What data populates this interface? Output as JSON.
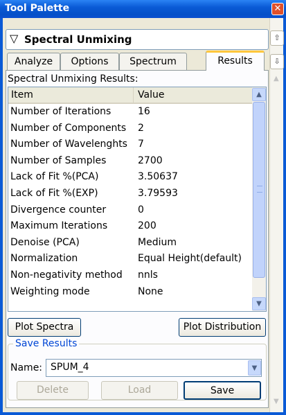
{
  "window": {
    "title": "Tool Palette",
    "close_glyph": "✕"
  },
  "header": {
    "label": "Spectral Unmixing",
    "collapse_glyph": "▽"
  },
  "tabs": [
    {
      "label": "Analyze"
    },
    {
      "label": "Options"
    },
    {
      "label": "Spectrum"
    },
    {
      "label": "Results",
      "active": true
    }
  ],
  "results": {
    "section_label": "Spectral Unmixing Results:",
    "columns": [
      "Item",
      "Value"
    ],
    "rows": [
      [
        "Number of Iterations",
        "16"
      ],
      [
        "Number of Components",
        "2"
      ],
      [
        "Number of Wavelenghts",
        "7"
      ],
      [
        "Number of Samples",
        "2700"
      ],
      [
        "Lack of Fit %(PCA)",
        "3.50637"
      ],
      [
        "Lack of Fit %(EXP)",
        "3.79593"
      ],
      [
        "Divergence counter",
        "0"
      ],
      [
        "Maximum Iterations",
        "200"
      ],
      [
        "Denoise (PCA)",
        "Medium"
      ],
      [
        "Normalization",
        "Equal Height(default)"
      ],
      [
        "Non-negativity method",
        "nnls"
      ],
      [
        "Weighting mode",
        "None"
      ]
    ]
  },
  "buttons": {
    "plot_spectra": "Plot Spectra",
    "plot_distribution": "Plot Distribution",
    "delete": "Delete",
    "load": "Load",
    "save": "Save"
  },
  "save_results": {
    "group_title": "Save Results",
    "name_label": "Name:",
    "name_value": "SPUM_4"
  },
  "icons": {
    "scroll_up": "▲",
    "scroll_down": "▼",
    "combo_arrow": "▼",
    "move_up": "⇧",
    "move_down": "⇩"
  }
}
